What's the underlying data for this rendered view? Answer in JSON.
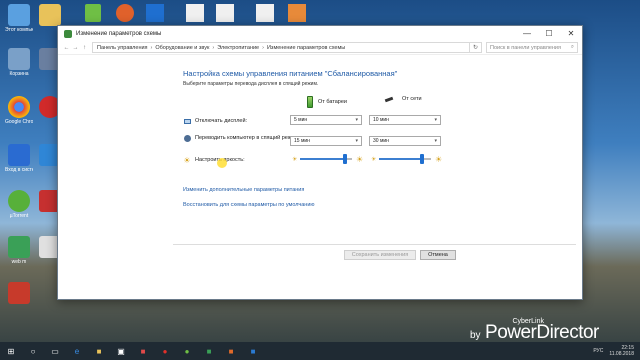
{
  "window": {
    "title": "Изменение параметров схемы",
    "controls": {
      "minimize": "—",
      "maximize": "☐",
      "close": "✕"
    }
  },
  "address": {
    "nav_back": "←",
    "nav_forward": "→",
    "nav_up": "↑",
    "crumbs": [
      "Панель управления",
      "Оборудование и звук",
      "Электропитание",
      "Изменение параметров схемы"
    ],
    "separator": "›",
    "refresh": "↻",
    "search_placeholder": "Поиск в панели управления"
  },
  "plan": {
    "heading": "Настройка схемы управления питанием \"Сбалансированная\"",
    "subheading": "Выберите параметры перевода дисплея в спящий режим.",
    "col_battery": "От батареи",
    "col_ac": "От сети",
    "rows": [
      {
        "label": "Отключать дисплей:",
        "battery": "5 мин",
        "ac": "10 мин"
      },
      {
        "label": "Переводить компьютер в спящий режим:",
        "battery": "15 мин",
        "ac": "30 мин"
      },
      {
        "label": "Настроить яркость:"
      }
    ],
    "brightness_battery": 0.9,
    "brightness_ac": 0.85,
    "link_advanced": "Изменить дополнительные параметры питания",
    "link_restore": "Восстановить для схемы параметры по умолчанию",
    "btn_save": "Сохранить изменения",
    "btn_cancel": "Отмена"
  },
  "desktop": {
    "icons": [
      {
        "label": "Этот компьютер",
        "color": "#5aa0e0"
      },
      {
        "label": "Корзина",
        "color": "#7aa0c8"
      },
      {
        "label": "Google Chrome",
        "color": "#e2483b"
      },
      {
        "label": "Вход в систему",
        "color": "#2a6bd1"
      },
      {
        "label": "µTorrent",
        "color": "#57b03a"
      },
      {
        "label": "web m",
        "color": "#3aa057"
      },
      {
        "label": "",
        "color": "#c73a2b"
      }
    ]
  },
  "taskbar": {
    "start": "⊞",
    "lang": "РУС",
    "time": "22:15",
    "date": "11.08.2018"
  },
  "watermark": {
    "small": "CyberLink",
    "by": "by",
    "brand": "PowerDirector"
  }
}
